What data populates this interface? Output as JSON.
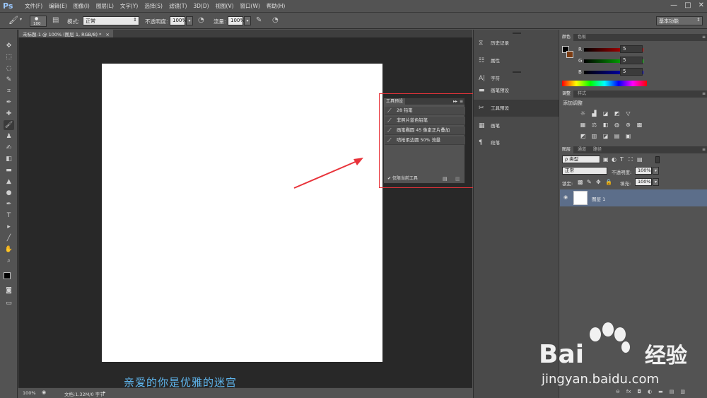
{
  "app": {
    "logo": "Ps"
  },
  "menu": [
    "文件(F)",
    "编辑(E)",
    "图像(I)",
    "图层(L)",
    "文字(Y)",
    "选择(S)",
    "滤镜(T)",
    "3D(D)",
    "视图(V)",
    "窗口(W)",
    "帮助(H)"
  ],
  "window_controls": {
    "minimize": "—",
    "restore": "□",
    "close": "✕"
  },
  "options": {
    "brush_size": "100",
    "mode_label": "模式:",
    "mode_value": "正常",
    "opacity_label": "不透明度:",
    "opacity_value": "100%",
    "flow_label": "流量:",
    "flow_value": "100%",
    "workspace": "基本功能"
  },
  "document": {
    "tab_title": "未标题-1 @ 100% (图层 1, RGB/8) *",
    "tab_close": "×",
    "zoom": "100%",
    "doc_info": "文档:1.32M/0 字节"
  },
  "subtitle": "亲爱的你是优雅的迷宫",
  "tool_presets": {
    "tab": "工具预设",
    "items": [
      "28 铅笔",
      "非照片蓝色铅笔",
      "画笔椭圆 45 像素正片叠加",
      "喷枪柔边圆 50% 流量"
    ],
    "footer": "✔ 仅限当前工具"
  },
  "dock": {
    "items": [
      {
        "icon": "history-icon",
        "label": "历史记录"
      },
      {
        "icon": "properties-icon",
        "label": "属性"
      },
      {
        "icon": "character-icon",
        "label": "字符"
      },
      {
        "icon": "brush-presets-icon",
        "label": "画笔预设"
      },
      {
        "icon": "tool-presets-icon",
        "label": "工具预设"
      },
      {
        "icon": "brush-icon",
        "label": "画笔"
      },
      {
        "icon": "paragraph-icon",
        "label": "段落"
      }
    ]
  },
  "color_panel": {
    "tabs": [
      "颜色",
      "色板"
    ],
    "channels": [
      {
        "name": "R",
        "value": "5"
      },
      {
        "name": "G",
        "value": "5"
      },
      {
        "name": "B",
        "value": "5"
      }
    ]
  },
  "adjustments_panel": {
    "tabs": [
      "调整",
      "样式"
    ],
    "title": "添加调整"
  },
  "layers_panel": {
    "tabs": [
      "图层",
      "通道",
      "路径"
    ],
    "filter": "ρ 类型",
    "blend_mode": "正常",
    "opacity_label": "不透明度:",
    "opacity_value": "100%",
    "lock_label": "锁定:",
    "fill_label": "填充:",
    "fill_value": "100%",
    "layers": [
      {
        "name": "图层 1",
        "visible": true
      }
    ]
  },
  "watermark": {
    "brand": "Bai",
    "brand2": "经验",
    "url": "jingyan.baidu.com"
  },
  "colors": {
    "highlight": "#e8333a",
    "subtitle": "#5fb6ee",
    "selected_layer": "#5c6e8a"
  }
}
